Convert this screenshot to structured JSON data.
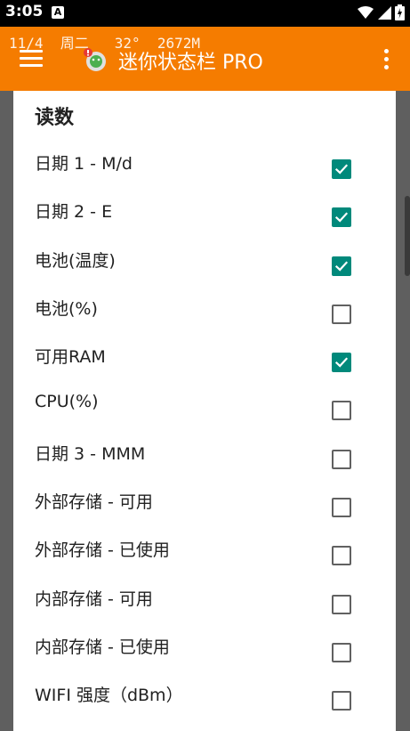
{
  "status_bar": {
    "time": "3:05",
    "notification_icon": "A",
    "icons": [
      "wifi-icon",
      "cell-signal-icon",
      "battery-icon"
    ]
  },
  "app_bar": {
    "overlay_readout": "11/4  周二   32°  2672M",
    "title": "迷你状态栏 PRO",
    "menu_icon": "hamburger-menu-icon",
    "overflow_icon": "overflow-menu-icon",
    "background_color": "#f57c00"
  },
  "section": {
    "header": "读数",
    "items": [
      {
        "label": "日期 1 - M/d",
        "checked": true
      },
      {
        "label": "日期 2 - E",
        "checked": true
      },
      {
        "label": "电池(温度)",
        "checked": true
      },
      {
        "label": "电池(%)",
        "checked": false
      },
      {
        "label": "可用RAM",
        "checked": true
      },
      {
        "label": "CPU(%)",
        "checked": false
      },
      {
        "label": "日期 3 - MMM",
        "checked": false
      },
      {
        "label": "外部存储 - 可用",
        "checked": false
      },
      {
        "label": "外部存储 - 已使用",
        "checked": false
      },
      {
        "label": "内部存储 - 可用",
        "checked": false
      },
      {
        "label": "内部存储 - 已使用",
        "checked": false
      },
      {
        "label": "WIFI 强度（dBm）",
        "checked": false
      }
    ]
  },
  "colors": {
    "checkbox_checked": "#00897b",
    "checkbox_unchecked_border": "#616161"
  }
}
